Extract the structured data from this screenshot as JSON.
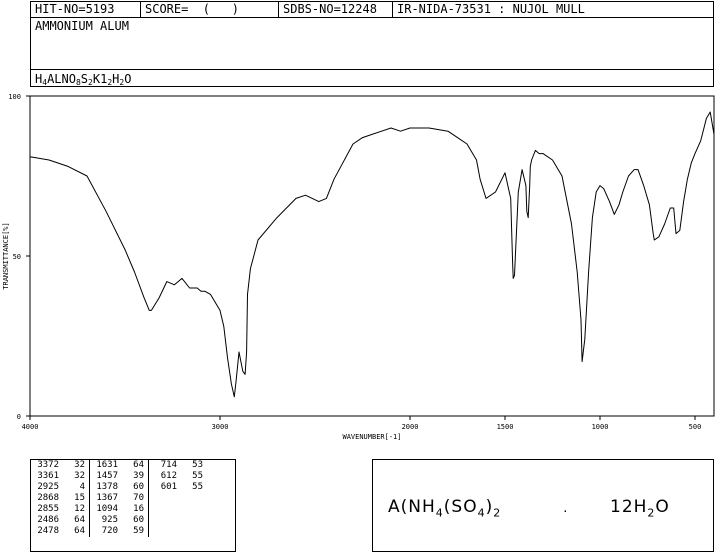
{
  "header": {
    "hit_no": "HIT-NO=5193",
    "score": "SCORE=  (   )",
    "sdbs_no": "SDBS-NO=12248",
    "ir_info": "IR-NIDA-73531 : NUJOL MULL",
    "compound_name": "AMMONIUM ALUM",
    "formula_parts": [
      "H",
      "4",
      "ALNO",
      "8",
      "S",
      "2",
      "K1",
      "2",
      "H",
      "2",
      "O"
    ]
  },
  "chart_data": {
    "type": "line",
    "title": "",
    "xlabel": "WAVENUMBER[-1]",
    "ylabel": "TRANSMITTANCE[%]",
    "xlim": [
      4000,
      400
    ],
    "ylim": [
      0,
      100
    ],
    "x_ticks": [
      4000,
      3000,
      2000,
      1500,
      1000,
      500
    ],
    "y_ticks": [
      0,
      50,
      100
    ],
    "grid": false,
    "series": [
      {
        "x": [
          4000,
          3900,
          3800,
          3700,
          3600,
          3500,
          3450,
          3400,
          3372,
          3361,
          3320,
          3280,
          3240,
          3200,
          3160,
          3120,
          3100,
          3080,
          3050,
          3000,
          2980,
          2960,
          2940,
          2925,
          2915,
          2900,
          2880,
          2868,
          2860,
          2855,
          2840,
          2800,
          2700,
          2600,
          2550,
          2480,
          2440,
          2400,
          2300,
          2250,
          2200,
          2100,
          2050,
          2000,
          1900,
          1800,
          1750,
          1700,
          1650,
          1631,
          1600,
          1550,
          1500,
          1470,
          1460,
          1457,
          1450,
          1430,
          1410,
          1390,
          1385,
          1378,
          1370,
          1367,
          1360,
          1340,
          1320,
          1300,
          1250,
          1200,
          1150,
          1120,
          1100,
          1094,
          1080,
          1060,
          1040,
          1020,
          1000,
          980,
          950,
          925,
          900,
          880,
          850,
          820,
          800,
          770,
          740,
          720,
          714,
          690,
          660,
          630,
          612,
          600,
          580,
          560,
          540,
          520,
          500,
          470,
          440,
          420,
          400
        ],
        "y": [
          81,
          80,
          78,
          75,
          64,
          52,
          45,
          37,
          33,
          33,
          37,
          42,
          41,
          43,
          40,
          40,
          39,
          39,
          38,
          33,
          28,
          18,
          10,
          6,
          11,
          20,
          14,
          13,
          20,
          38,
          46,
          55,
          62,
          68,
          69,
          67,
          68,
          74,
          85,
          87,
          88,
          90,
          89,
          90,
          90,
          89,
          87,
          85,
          80,
          74,
          68,
          70,
          76,
          68,
          48,
          43,
          44,
          70,
          77,
          72,
          64,
          62,
          72,
          78,
          80,
          83,
          82,
          82,
          80,
          75,
          60,
          45,
          30,
          17,
          24,
          45,
          62,
          70,
          72,
          71,
          67,
          63,
          66,
          70,
          75,
          77,
          77,
          72,
          66,
          57,
          55,
          56,
          60,
          65,
          65,
          57,
          58,
          67,
          74,
          79,
          82,
          86,
          93,
          95,
          88
        ]
      }
    ],
    "peak_table": [
      [
        "3372",
        "32"
      ],
      [
        "3361",
        "32"
      ],
      [
        "2925",
        "4"
      ],
      [
        "2868",
        "15"
      ],
      [
        "2855",
        "12"
      ],
      [
        "2486",
        "64"
      ],
      [
        "2478",
        "64"
      ],
      [
        "1631",
        "64"
      ],
      [
        "1457",
        "39"
      ],
      [
        "1378",
        "60"
      ],
      [
        "1367",
        "70"
      ],
      [
        "1094",
        "16"
      ],
      [
        "925",
        "60"
      ],
      [
        "720",
        "59"
      ],
      [
        "714",
        "53"
      ],
      [
        "612",
        "55"
      ],
      [
        "601",
        "55"
      ]
    ]
  },
  "structure": {
    "parts": [
      "A",
      "(",
      "NH",
      "4",
      "(",
      "SO",
      "4",
      ")",
      "2"
    ],
    "separator": "·",
    "water_parts": [
      "12H",
      "2",
      "O"
    ]
  }
}
